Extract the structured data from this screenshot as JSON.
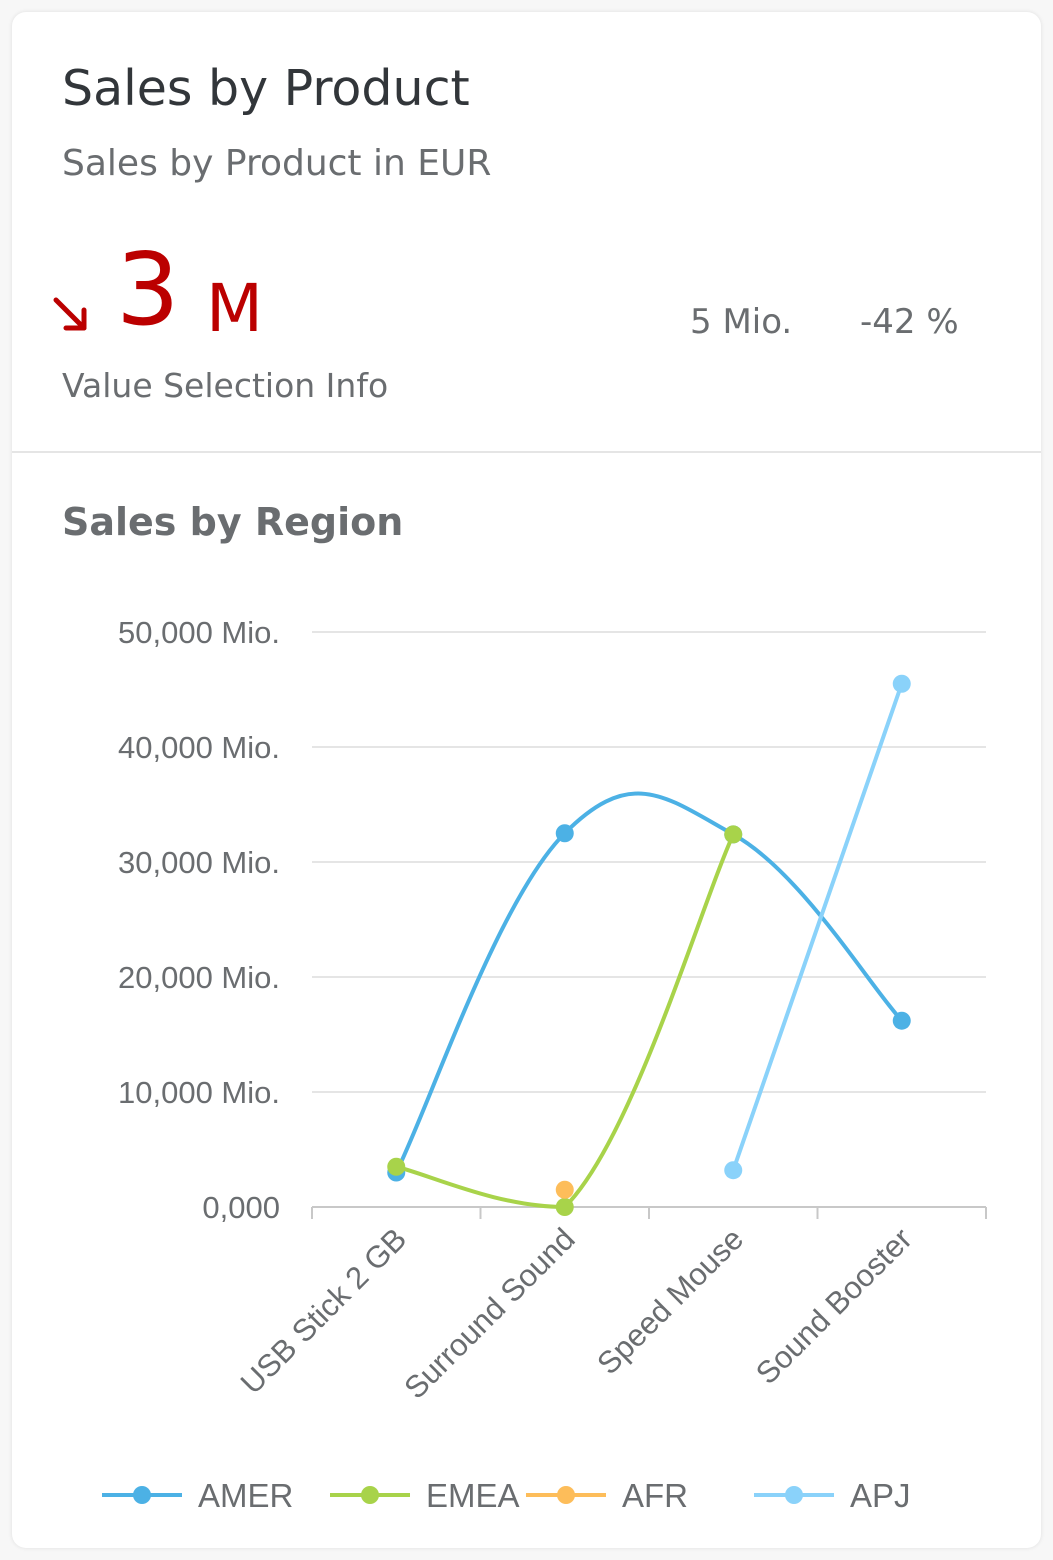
{
  "header": {
    "title": "Sales by Product",
    "subtitle": "Sales by Product in EUR"
  },
  "kpi": {
    "value": "3",
    "unit": "M",
    "trend": "down",
    "trend_icon": "arrow-down-right-icon",
    "target": "5 Mio.",
    "deviation": "-42 %",
    "info": "Value Selection Info",
    "color": "#bb0000"
  },
  "section": {
    "title": "Sales by Region"
  },
  "chart_data": {
    "type": "line",
    "title": "",
    "xlabel": "",
    "ylabel": "",
    "categories": [
      "USB Stick 2 GB",
      "Surround Sound",
      "Speed Mouse",
      "Sound Booster"
    ],
    "ylim": [
      0,
      50000
    ],
    "yticks": [
      {
        "value": 0,
        "label": "0,000"
      },
      {
        "value": 10000,
        "label": "10,000 Mio."
      },
      {
        "value": 20000,
        "label": "20,000 Mio."
      },
      {
        "value": 30000,
        "label": "30,000 Mio."
      },
      {
        "value": 40000,
        "label": "40,000 Mio."
      },
      {
        "value": 50000,
        "label": "50,000 Mio."
      }
    ],
    "grid": true,
    "legend_position": "bottom",
    "series": [
      {
        "name": "AMER",
        "color": "#4cb1e5",
        "values": [
          3000,
          32500,
          32400,
          16200
        ]
      },
      {
        "name": "EMEA",
        "color": "#a8d34a",
        "values": [
          3500,
          0,
          32400,
          null
        ]
      },
      {
        "name": "AFR",
        "color": "#fdbd5a",
        "values": [
          null,
          1500,
          null,
          null
        ]
      },
      {
        "name": "APJ",
        "color": "#8ad2fa",
        "values": [
          null,
          null,
          3200,
          45500
        ]
      }
    ]
  }
}
